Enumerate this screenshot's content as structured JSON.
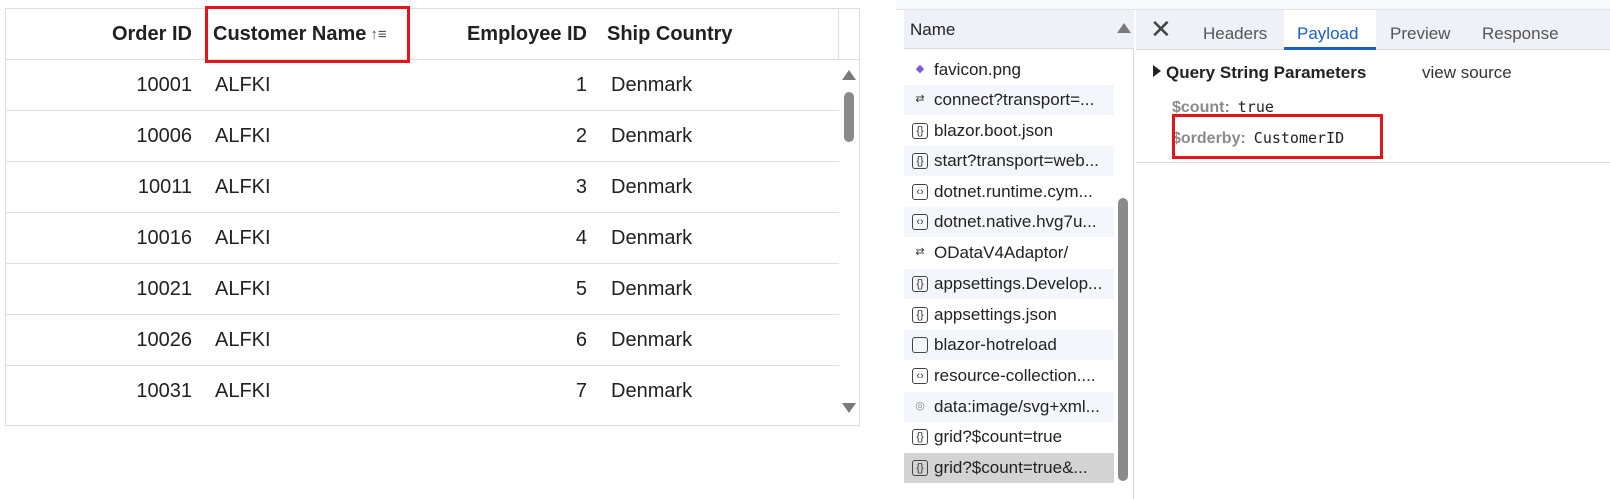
{
  "grid": {
    "columns": [
      {
        "label": "Order ID"
      },
      {
        "label": "Customer Name",
        "sort_icon": "↑≡"
      },
      {
        "label": "Employee ID"
      },
      {
        "label": "Ship Country"
      }
    ],
    "rows": [
      [
        "10001",
        "ALFKI",
        "1",
        "Denmark"
      ],
      [
        "10006",
        "ALFKI",
        "2",
        "Denmark"
      ],
      [
        "10011",
        "ALFKI",
        "3",
        "Denmark"
      ],
      [
        "10016",
        "ALFKI",
        "4",
        "Denmark"
      ],
      [
        "10021",
        "ALFKI",
        "5",
        "Denmark"
      ],
      [
        "10026",
        "ALFKI",
        "6",
        "Denmark"
      ],
      [
        "10031",
        "ALFKI",
        "7",
        "Denmark"
      ]
    ]
  },
  "devtools": {
    "name_header": "Name",
    "requests": [
      {
        "label": "favicon.png",
        "icon": "image-icon"
      },
      {
        "label": "connect?transport=...",
        "icon": "websocket-icon"
      },
      {
        "label": "blazor.boot.json",
        "icon": "json-icon"
      },
      {
        "label": "start?transport=web...",
        "icon": "json-icon"
      },
      {
        "label": "dotnet.runtime.cym...",
        "icon": "script-icon"
      },
      {
        "label": "dotnet.native.hvg7u...",
        "icon": "script-icon"
      },
      {
        "label": "ODataV4Adaptor/",
        "icon": "websocket-icon"
      },
      {
        "label": "appsettings.Develop...",
        "icon": "json-icon"
      },
      {
        "label": "appsettings.json",
        "icon": "json-icon"
      },
      {
        "label": "blazor-hotreload",
        "icon": "document-icon"
      },
      {
        "label": "resource-collection....",
        "icon": "script-icon"
      },
      {
        "label": "data:image/svg+xml...",
        "icon": "svg-data-icon"
      },
      {
        "label": "grid?$count=true",
        "icon": "json-icon"
      },
      {
        "label": "grid?$count=true&...",
        "icon": "json-icon"
      }
    ],
    "tabs": [
      "Headers",
      "Payload",
      "Preview",
      "Response"
    ],
    "active_tab": "Payload",
    "section_title": "Query String Parameters",
    "view_source": "view source",
    "params": [
      {
        "key": "$count:",
        "value": "true"
      },
      {
        "key": "$orderby:",
        "value": "CustomerID"
      }
    ]
  }
}
